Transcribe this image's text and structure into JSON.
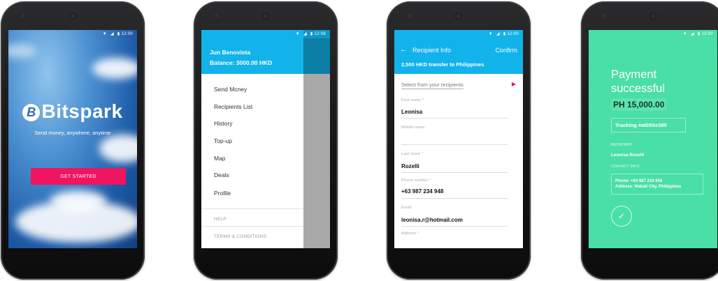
{
  "status": {
    "time_1": "12:00",
    "time_2": "12:08",
    "time_3": "12:00",
    "time_4": "12:00"
  },
  "welcome": {
    "logo_text": "Bitspark",
    "tagline": "Send money, anywhere, anytime",
    "cta_label": "GET STARTED"
  },
  "drawer": {
    "user_name": "Jun Benovista",
    "balance": "Balance: 3000.00 HKD",
    "items": [
      "Send Mcney",
      "Recipients List",
      "History",
      "Top-up",
      "Map",
      "Deals",
      "Profile"
    ],
    "help": "HELP",
    "terms": "TERMS & CONDITIONS"
  },
  "recipient": {
    "back_icon": "back-arrow-icon",
    "title": "Recipient Info",
    "confirm": "Confirm",
    "subtitle": "2,500 HKD transfer to Philippines",
    "select_label": "Select from your recipients",
    "fields": [
      {
        "label": "First name *",
        "value": "Leonisa"
      },
      {
        "label": "Middle name",
        "value": ""
      },
      {
        "label": "Last name *",
        "value": "Rozelli"
      },
      {
        "label": "Phone number *",
        "value": "+63 987 234 948"
      },
      {
        "label": "Email",
        "value": "leonisa.r@hotmail.com"
      },
      {
        "label": "Address *",
        "value": ""
      }
    ]
  },
  "success": {
    "title": "Payment successful",
    "amount": "PH 15,000.00",
    "tracking": "Tracking #at09Xe385",
    "recipient_label": "RECEPIENT",
    "recipient_name": "Leonisa Rozelli",
    "contact_label": "CONTACT INFO",
    "phone": "Phone: +63 987 234 948",
    "address": "Address: Makati City, Philippines"
  },
  "colors": {
    "accent_blue": "#12b3ea",
    "cta_pink": "#ef1560",
    "success_green": "#49dfa7"
  }
}
